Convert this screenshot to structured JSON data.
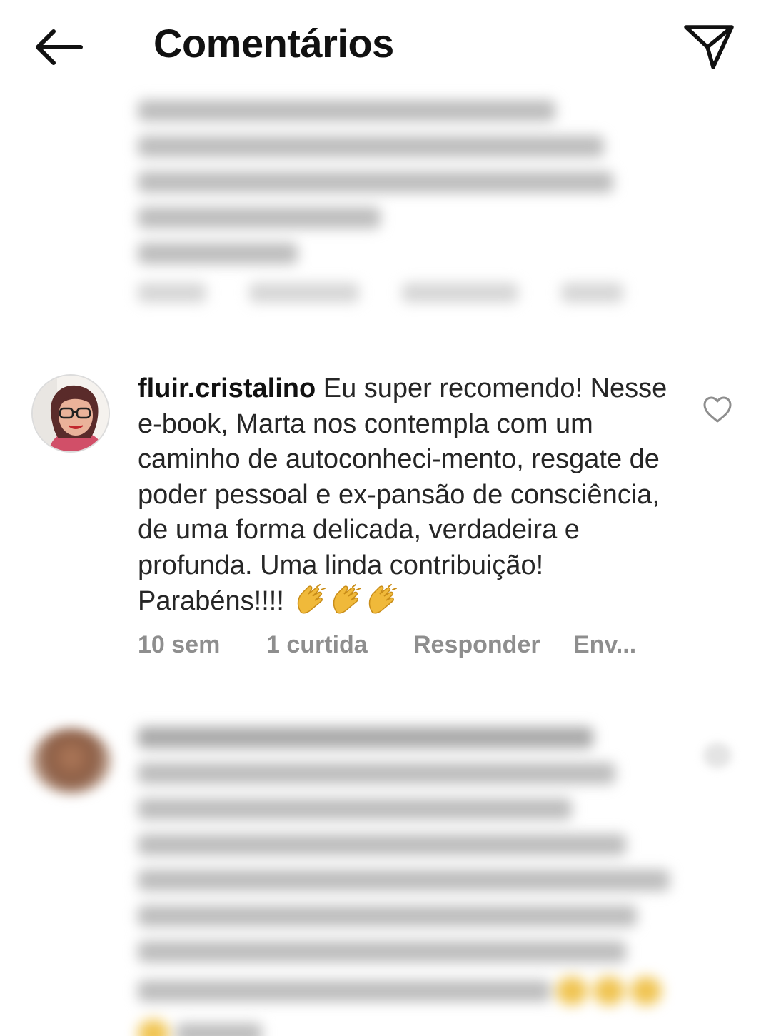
{
  "header": {
    "title": "Comentários",
    "back_icon": "arrow-left-icon",
    "send_icon": "paper-plane-icon"
  },
  "comment": {
    "username": "fluir.cristalino",
    "text": " Eu super recomendo! Nesse e-book, Marta nos contempla com um caminho de autoconheci-mento, resgate de poder pessoal e ex-pansão de consciência, de uma forma delicada, verdadeira e profunda. Uma linda contribuição! Parabéns!!!! ",
    "emojis": [
      "clapping-hands",
      "clapping-hands",
      "clapping-hands"
    ],
    "time": "10 sem",
    "likes": "1 curtida",
    "reply_label": "Responder",
    "send_label": "Env..."
  },
  "colors": {
    "text": "#262626",
    "meta": "#8e8e8e",
    "emoji": "#f0b93a"
  }
}
